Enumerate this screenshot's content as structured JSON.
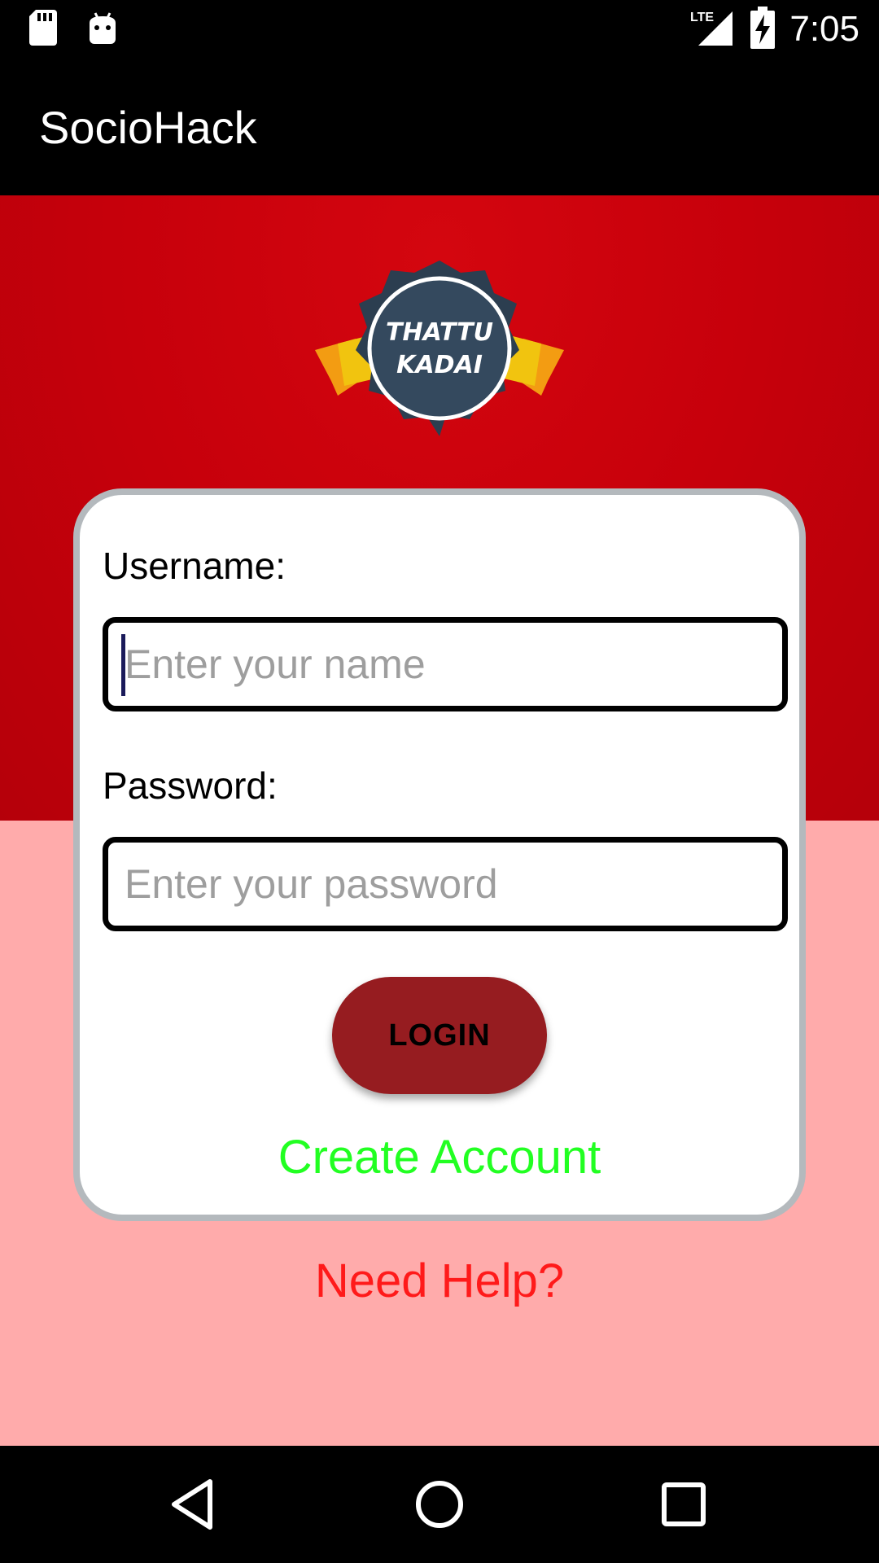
{
  "status_bar": {
    "time": "7:05",
    "network": "LTE",
    "icons": [
      "sd-card-icon",
      "android-icon",
      "lte-signal-icon",
      "battery-charging-icon"
    ]
  },
  "app_bar": {
    "title": "SocioHack"
  },
  "badge": {
    "line1": "THATTU",
    "line2": "KADAI"
  },
  "login_form": {
    "username_label": "Username:",
    "username_placeholder": "Enter your name",
    "username_value": "",
    "password_label": "Password:",
    "password_placeholder": "Enter your password",
    "password_value": "",
    "login_label": "LOGIN",
    "create_account_label": "Create Account"
  },
  "help_label": "Need Help?",
  "nav_bar": {
    "icons": [
      "back-icon",
      "home-icon",
      "recents-icon"
    ]
  },
  "colors": {
    "header_red": "#c7000b",
    "content_pink": "#ffabab",
    "login_button": "#961c20",
    "create_account": "#22ff22",
    "need_help": "#ff1a1a",
    "card_border": "#b4b9bd"
  }
}
